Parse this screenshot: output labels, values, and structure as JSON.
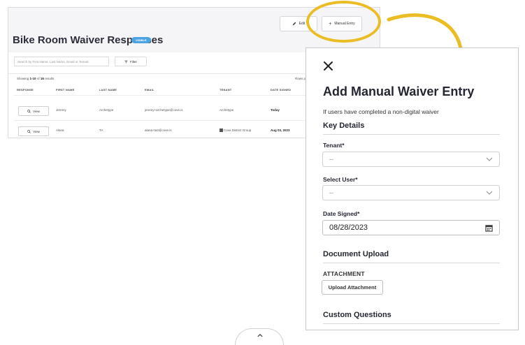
{
  "background_page": {
    "title": "Bike Room Waiver Responses",
    "badge": "VISIBLE",
    "edit_label": "Edit",
    "manual_entry_label": "Manual Entry",
    "search_placeholder": "Search by First Name, Last Name, Email or Tenant",
    "filter_label": "Filter",
    "showing_prefix": "Showing",
    "showing_range": "1-10",
    "showing_of": "of",
    "showing_total": "16",
    "showing_suffix": "results",
    "rows_per_page_label": "Rows p",
    "columns": [
      "RESPONSE",
      "FIRST NAME",
      "LAST NAME",
      "EMAIL",
      "TENANT",
      "DATE SIGNED"
    ],
    "view_label": "View",
    "rows": [
      {
        "first": "Jeremy",
        "last": "Archetype",
        "email": "jeremy+archetype@cove.is",
        "tenant": "Archetype",
        "date": "Today"
      },
      {
        "first": "Alana",
        "last": "TA",
        "email": "alana+ta2@cove.is",
        "tenant": "Cove District Group",
        "date": "Aug 03, 2023"
      }
    ]
  },
  "callout": {
    "accent_color": "#ebbd24"
  },
  "modal": {
    "title": "Add Manual Waiver Entry",
    "subtitle": "If users have completed a non-digital waiver",
    "key_details_heading": "Key Details",
    "tenant_label": "Tenant*",
    "tenant_value": "--",
    "user_label": "Select User*",
    "user_value": "--",
    "date_label": "Date Signed*",
    "date_value": "08/28/2023",
    "document_upload_heading": "Document Upload",
    "attachment_label": "ATTACHMENT",
    "upload_button": "Upload Attachment",
    "custom_questions_heading": "Custom Questions"
  }
}
